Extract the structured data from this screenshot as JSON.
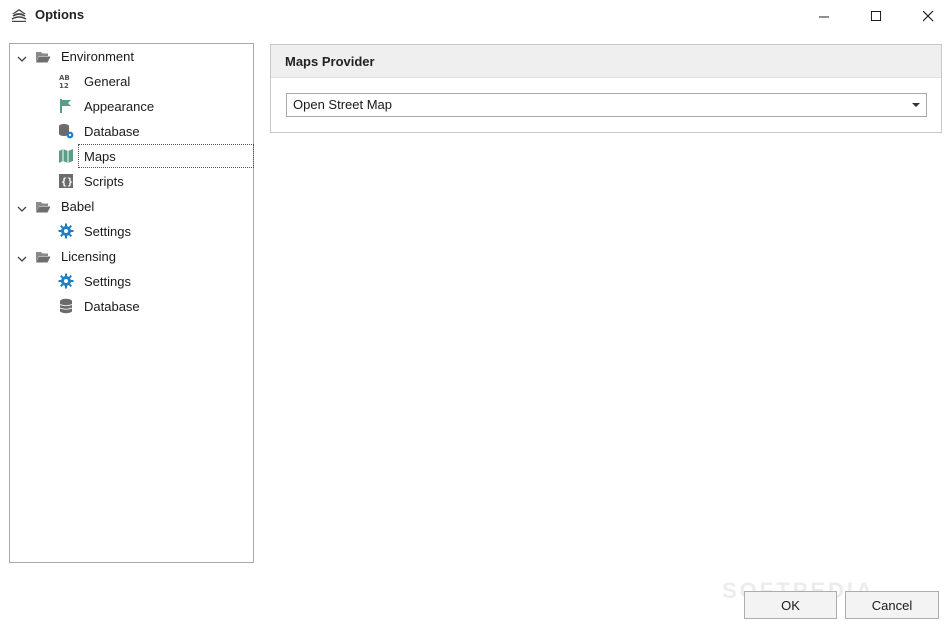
{
  "window": {
    "title": "Options",
    "minimize_icon": "minimize-icon",
    "maximize_icon": "maximize-icon",
    "close_icon": "close-icon"
  },
  "tree": {
    "nodes": [
      {
        "label": "Environment",
        "icon": "folder-open-icon",
        "expanded": true,
        "children": [
          {
            "label": "General",
            "icon": "ab12-text-icon"
          },
          {
            "label": "Appearance",
            "icon": "flag-icon"
          },
          {
            "label": "Database",
            "icon": "database-gear-icon"
          },
          {
            "label": "Maps",
            "icon": "map-icon",
            "selected": true
          },
          {
            "label": "Scripts",
            "icon": "braces-icon"
          }
        ]
      },
      {
        "label": "Babel",
        "icon": "folder-open-icon",
        "expanded": true,
        "children": [
          {
            "label": "Settings",
            "icon": "gear-icon"
          }
        ]
      },
      {
        "label": "Licensing",
        "icon": "folder-open-icon",
        "expanded": true,
        "children": [
          {
            "label": "Settings",
            "icon": "gear-icon"
          },
          {
            "label": "Database",
            "icon": "database-icon"
          }
        ]
      }
    ]
  },
  "maps_provider": {
    "title": "Maps Provider",
    "selected": "Open Street Map"
  },
  "buttons": {
    "ok": "OK",
    "cancel": "Cancel"
  },
  "watermark": "SOFTPEDIA",
  "colors": {
    "header_bg": "#efefef",
    "gear_blue": "#1e7fc7",
    "map_green": "#5a9e8a"
  }
}
